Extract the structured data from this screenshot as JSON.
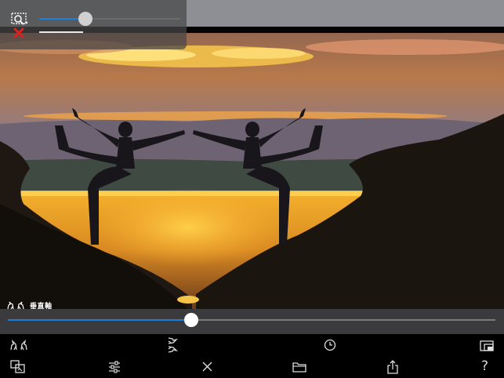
{
  "photo": {
    "description_icon": "photo-canvas"
  },
  "zoom": {
    "icon": "zoom-preview-icon",
    "level": 0.33,
    "accent": "#1e7fd8"
  },
  "overlay": {
    "close_icon": "close-icon",
    "close_color": "#e0201b"
  },
  "axis": {
    "label": "垂直軸",
    "icon": "mirror-animals-icon",
    "level": 0.377,
    "accent": "#1e7fd8"
  },
  "toolbar": {
    "row1": [
      "mirror-horizontal-icon",
      "mirror-vertical-icon",
      "timer-icon",
      "layers-icon"
    ],
    "row2": [
      "crop-copy-icon",
      "sliders-icon",
      "close-icon",
      "folder-icon",
      "share-icon"
    ],
    "help_label": "?"
  }
}
